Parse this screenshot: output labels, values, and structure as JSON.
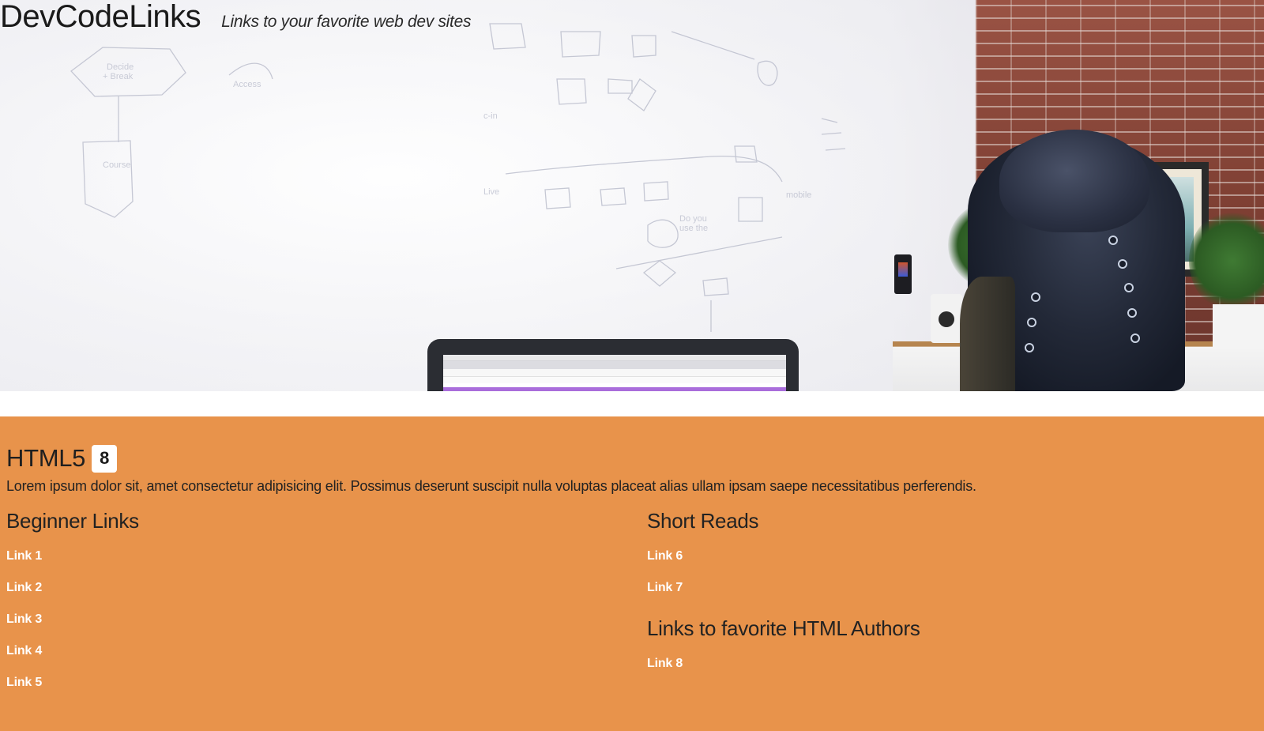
{
  "brand": {
    "title": "DevCodeLinks",
    "tagline": "Links to your favorite web dev sites"
  },
  "section": {
    "title": "HTML5",
    "badge": "8",
    "intro": "Lorem ipsum dolor sit, amet consectetur adipisicing elit. Possimus deserunt suscipit nulla voluptas placeat alias ullam ipsam saepe necessitatibus perferendis.",
    "columns": [
      {
        "title": "Beginner Links",
        "links": [
          "Link 1",
          "Link 2",
          "Link 3",
          "Link 4",
          "Link 5"
        ]
      },
      {
        "title": "Short Reads",
        "links": [
          "Link 6",
          "Link 7"
        ]
      },
      {
        "title": "Links to favorite HTML Authors",
        "links": [
          "Link 8"
        ]
      }
    ]
  },
  "colors": {
    "section_background": "#e8934b",
    "link_color": "#ffffff",
    "badge_background": "#ffffff"
  }
}
